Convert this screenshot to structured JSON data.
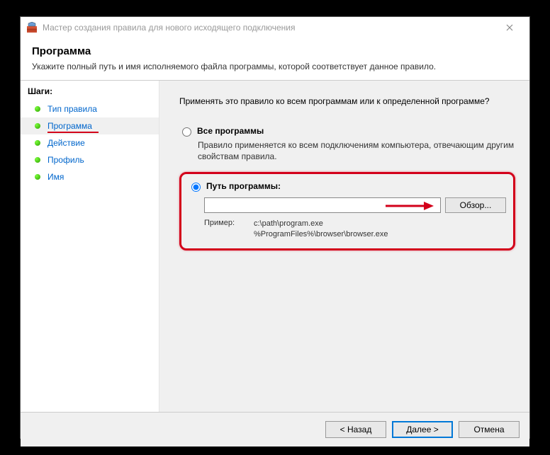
{
  "titlebar": {
    "title": "Мастер создания правила для нового исходящего подключения"
  },
  "header": {
    "title": "Программа",
    "description": "Укажите полный путь и имя исполняемого файла программы, которой соответствует данное правило."
  },
  "sidebar": {
    "header": "Шаги:",
    "steps": [
      {
        "label": "Тип правила"
      },
      {
        "label": "Программа"
      },
      {
        "label": "Действие"
      },
      {
        "label": "Профиль"
      },
      {
        "label": "Имя"
      }
    ]
  },
  "content": {
    "question": "Применять это правило ко всем программам или к определенной программе?",
    "all_programs_label": "Все программы",
    "all_programs_desc": "Правило применяется ко всем подключениям компьютера, отвечающим другим свойствам правила.",
    "program_path_label": "Путь программы:",
    "path_value": "",
    "browse_label": "Обзор...",
    "example_label": "Пример:",
    "example_path1": "c:\\path\\program.exe",
    "example_path2": "%ProgramFiles%\\browser\\browser.exe"
  },
  "footer": {
    "back": "< Назад",
    "next": "Далее >",
    "cancel": "Отмена"
  }
}
